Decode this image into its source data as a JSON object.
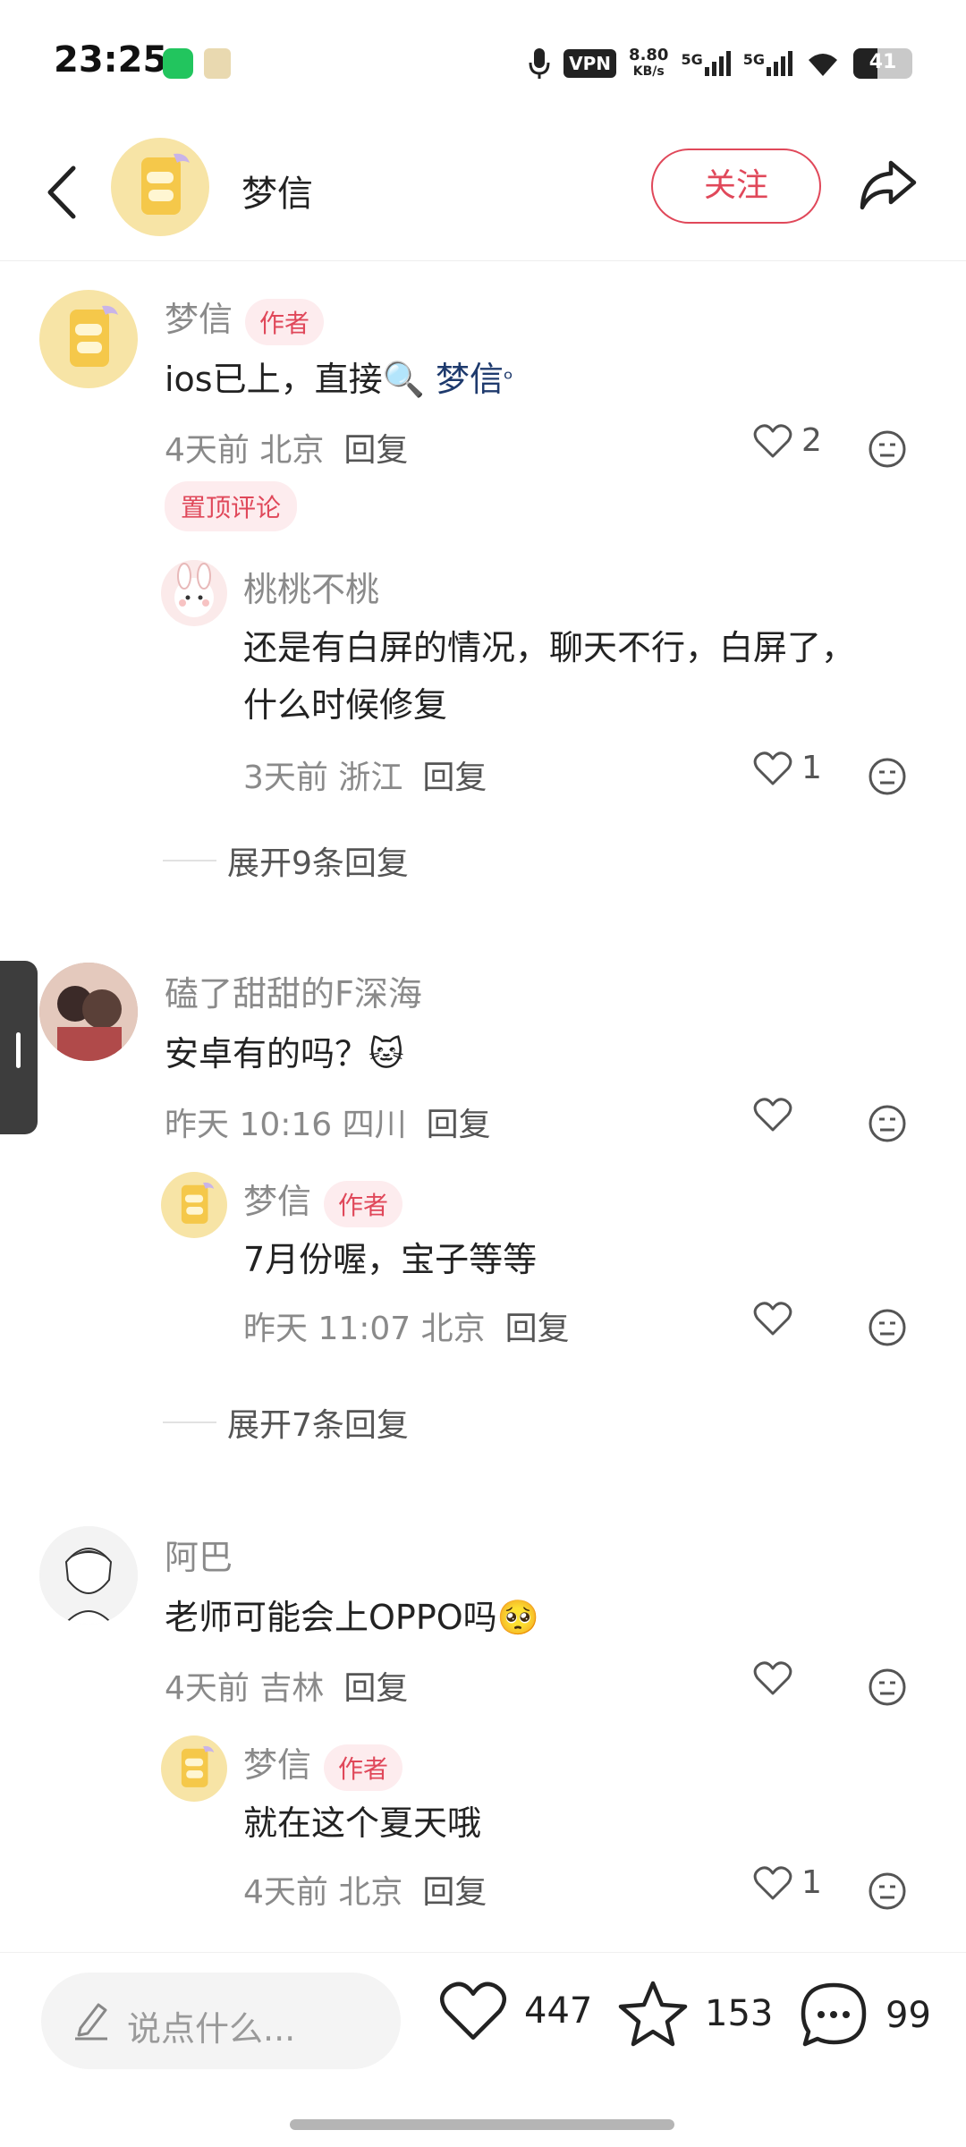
{
  "status_bar": {
    "time": "23:25",
    "vpn_label": "VPN",
    "net_speed_value": "8.80",
    "net_speed_unit": "KB/s",
    "signal1_label": "5G",
    "signal2_label": "5G",
    "battery_level": "41",
    "icons": [
      "wechat-icon",
      "app-icon",
      "mic-icon",
      "wifi-icon",
      "battery-icon"
    ]
  },
  "header": {
    "name": "梦信",
    "follow_label": "关注"
  },
  "comments": [
    {
      "name": "梦信",
      "badge": "作者",
      "text_prefix": "ios已上，直接🔍",
      "mention": "梦信",
      "time": "4天前",
      "location": "北京",
      "reply_label": "回复",
      "likes": "2",
      "pinned_label": "置顶评论",
      "replies": [
        {
          "name": "桃桃不桃",
          "text_line1": "还是有白屏的情况，聊天不行，白屏了，",
          "text_line2": "什么时候修复",
          "time": "3天前",
          "location": "浙江",
          "reply_label": "回复",
          "likes": "1"
        }
      ],
      "expand_label": "展开9条回复"
    },
    {
      "name": "磕了甜甜的F深海",
      "text": "安卓有的吗？🐱",
      "time": "昨天 10:16",
      "location": "四川",
      "reply_label": "回复",
      "replies": [
        {
          "name": "梦信",
          "badge": "作者",
          "text": "7月份喔，宝子等等",
          "time": "昨天 11:07",
          "location": "北京",
          "reply_label": "回复"
        }
      ],
      "expand_label": "展开7条回复"
    },
    {
      "name": "阿巴",
      "text": "老师可能会上OPPO吗🥺",
      "time": "4天前",
      "location": "吉林",
      "reply_label": "回复",
      "replies": [
        {
          "name": "梦信",
          "badge": "作者",
          "text": "就在这个夏天哦",
          "time": "4天前",
          "location": "北京",
          "reply_label": "回复",
          "likes": "1"
        }
      ]
    }
  ],
  "bottom_bar": {
    "input_placeholder": "说点什么...",
    "likes": "447",
    "favorites": "153",
    "comments": "99"
  },
  "colors": {
    "accent": "#e0485a",
    "mention": "#1e3a6d",
    "muted": "#8a8a8a"
  }
}
